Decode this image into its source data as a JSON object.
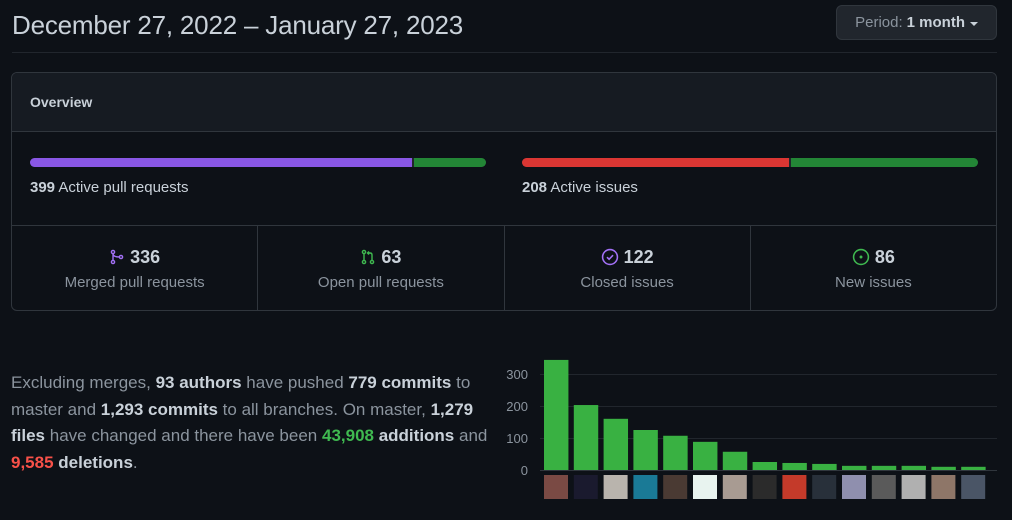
{
  "header": {
    "title": "December 27, 2022 – January 27, 2023",
    "period_label": "Period:",
    "period_value": "1 month"
  },
  "overview": {
    "title": "Overview",
    "pull_requests_bar": {
      "count": "399",
      "label": "Active pull requests",
      "merged_fraction": 0.842,
      "open_fraction": 0.158,
      "merged_color": "#8957e5",
      "open_color": "#238636"
    },
    "issues_bar": {
      "count": "208",
      "label": "Active issues",
      "closed_fraction": 0.587,
      "new_fraction": 0.413,
      "closed_color": "#da3633",
      "new_color": "#238636"
    },
    "stats": [
      {
        "icon": "git-merge-icon",
        "value": "336",
        "label": "Merged pull requests",
        "color": "#a371f7"
      },
      {
        "icon": "git-pull-request-icon",
        "value": "63",
        "label": "Open pull requests",
        "color": "#3fb950"
      },
      {
        "icon": "issue-closed-icon",
        "value": "122",
        "label": "Closed issues",
        "color": "#a371f7"
      },
      {
        "icon": "issue-opened-icon",
        "value": "86",
        "label": "New issues",
        "color": "#3fb950"
      }
    ]
  },
  "summary": {
    "t1": "Excluding merges, ",
    "authors": "93 authors",
    "t2": " have pushed ",
    "commits_master": "779 commits",
    "t3": " to master and ",
    "commits_all": "1,293 commits",
    "t4": " to all branches. On master, ",
    "files": "1,279 files",
    "t5": " have changed and there have been ",
    "additions_num": "43,908",
    "additions_word": " additions",
    "t6": " and ",
    "deletions_num": "9,585",
    "deletions_word": " deletions",
    "t7": "."
  },
  "chart_data": {
    "type": "bar",
    "title": "",
    "xlabel": "",
    "ylabel": "",
    "ylim": [
      0,
      350
    ],
    "yticks": [
      0,
      100,
      200,
      300
    ],
    "grid": true,
    "bar_color": "#39b142",
    "categories": [
      "author-1",
      "author-2",
      "author-3",
      "author-4",
      "author-5",
      "author-6",
      "author-7",
      "author-8",
      "author-9",
      "author-10",
      "author-11",
      "author-12",
      "author-13",
      "author-14",
      "author-15"
    ],
    "values": [
      344,
      203,
      160,
      125,
      107,
      88,
      57,
      25,
      22,
      19,
      13,
      13,
      13,
      10,
      10
    ],
    "avatar_colors": [
      "#7a4a44",
      "#1a1a2e",
      "#b9b4ad",
      "#1a7a96",
      "#4a3a33",
      "#e8f3ef",
      "#a89b92",
      "#2b2b2b",
      "#c43a2a",
      "#28303a",
      "#8f8fae",
      "#5a5a5a",
      "#b0b0b0",
      "#8e7668",
      "#4a5566"
    ]
  }
}
